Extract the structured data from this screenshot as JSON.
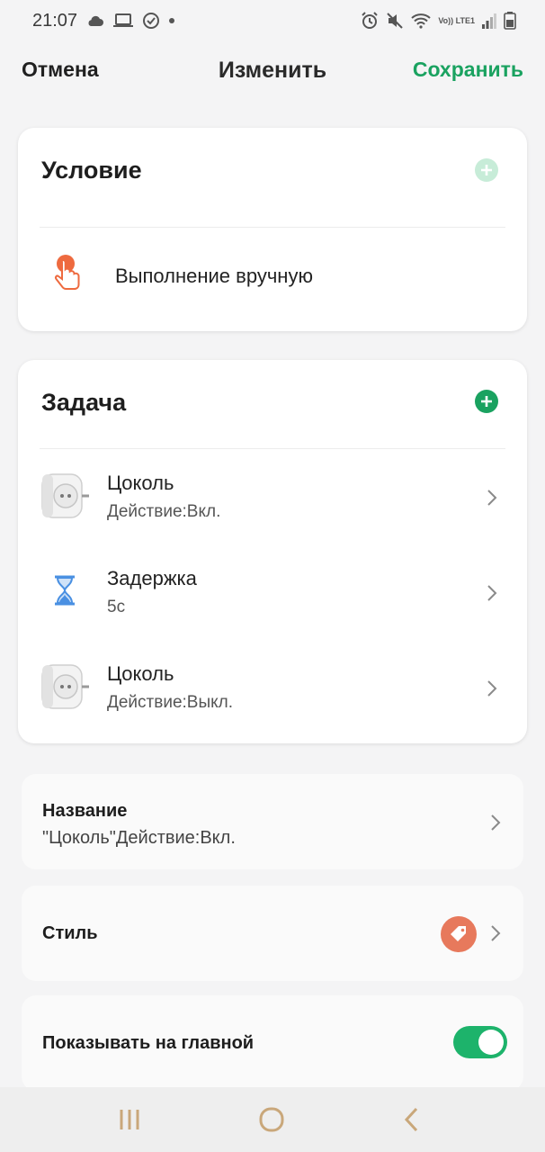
{
  "status_bar": {
    "time": "21:07",
    "icons_left": [
      "cloud-icon",
      "laptop-icon",
      "check-circle-icon",
      "dot-icon"
    ],
    "network_label": "Vo)) LTE1",
    "icons_right": [
      "alarm-icon",
      "mute-icon",
      "wifi-icon",
      "signal-icon",
      "battery-icon"
    ]
  },
  "header": {
    "cancel": "Отмена",
    "title": "Изменить",
    "save": "Сохранить",
    "save_color": "#1aa260"
  },
  "condition": {
    "title": "Условие",
    "add_color": "#bfe9d2",
    "item": {
      "title": "Выполнение вручную",
      "icon": "hand-tap-icon",
      "icon_color": "#ee6a3f"
    }
  },
  "task": {
    "title": "Задача",
    "add_color": "#1aa260",
    "items": [
      {
        "title": "Цоколь",
        "subtitle": "Действие:Вкл.",
        "icon": "smart-plug-icon"
      },
      {
        "title": "Задержка",
        "subtitle": "5с",
        "icon": "hourglass-icon"
      },
      {
        "title": "Цоколь",
        "subtitle": "Действие:Выкл.",
        "icon": "smart-plug-icon"
      }
    ]
  },
  "settings": {
    "name": {
      "label": "Название",
      "value": "\"Цоколь\"Действие:Вкл."
    },
    "style": {
      "label": "Стиль",
      "badge_color": "#e7795c",
      "icon": "tag-icon"
    },
    "show_home": {
      "label": "Показывать на главной",
      "enabled": true,
      "toggle_color": "#1db36b"
    }
  },
  "nav": {
    "buttons": [
      "recent-apps-icon",
      "home-icon",
      "back-icon"
    ]
  }
}
